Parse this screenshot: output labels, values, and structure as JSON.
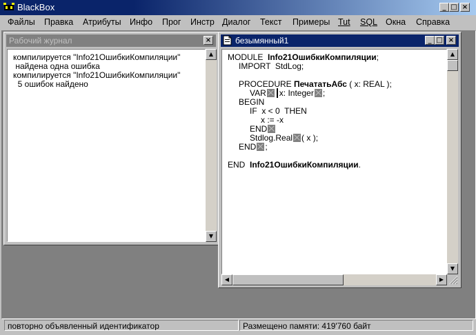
{
  "window": {
    "title": "BlackBox"
  },
  "menu": {
    "items": [
      {
        "label": "Файлы"
      },
      {
        "label": "Правка"
      },
      {
        "label": "Атрибуты"
      },
      {
        "label": "Инфо"
      },
      {
        "label": "Прог"
      },
      {
        "label": "Инстр"
      },
      {
        "label": "Диалог"
      },
      {
        "label": "Текст"
      },
      {
        "label": "Примеры"
      },
      {
        "label": "Tut"
      },
      {
        "label": "SQL"
      },
      {
        "label": "Окна"
      },
      {
        "label": "Справка"
      }
    ]
  },
  "log_window": {
    "title": "Рабочий журнал",
    "lines": [
      "компилируется \"Info21ОшибкиКомпиляции\"",
      " найдена одна ошибка",
      "компилируется \"Info21ОшибкиКомпиляции\"",
      "  5 ошибок найдено"
    ]
  },
  "editor_window": {
    "title": "безымянный1",
    "code": {
      "l1_kw": "MODULE",
      "l1_name": "Info21ОшибкиКомпиляции",
      "l1_end": ";",
      "l2": "IMPORT  StdLog;",
      "l3_kw": "PROCEDURE",
      "l3_name": "ПечататьАбс",
      "l3_rest": "( x: REAL );",
      "l4_a": "VAR",
      "l4_b": "x: Integer",
      "l4_c": ";",
      "l5": "BEGIN",
      "l6": "IF  x < 0  THEN",
      "l7": "x := -x",
      "l8": "END",
      "l9_a": "Stdlog.Real",
      "l9_b": "( x );",
      "l10_a": "END",
      "l10_b": ";",
      "l11_kw": "END",
      "l11_name": "Info21ОшибкиКомпиляции",
      "l11_end": "."
    }
  },
  "status": {
    "message": "повторно объявленный идентификатор",
    "memory": "Размещено памяти: 419'760 байт"
  },
  "colors": {
    "active_title": "#0a246a",
    "inactive_title": "#808080",
    "workspace": "#808080",
    "error_marker": "#808080"
  }
}
